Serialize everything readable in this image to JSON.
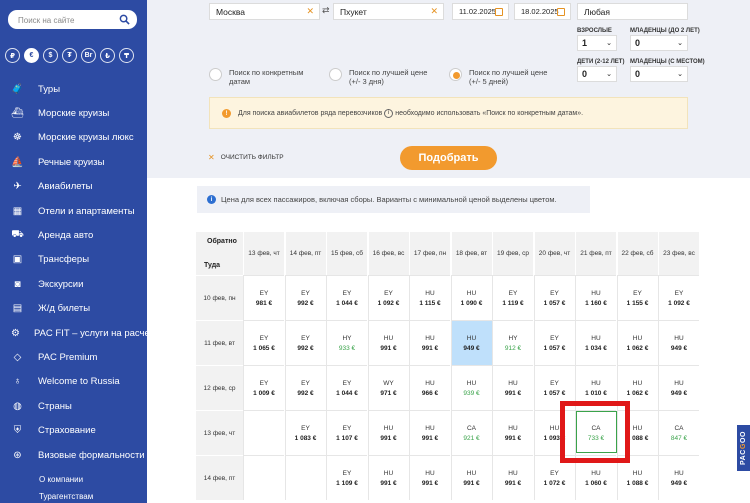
{
  "sidebar": {
    "search_placeholder": "Поиск на сайте",
    "currencies": [
      "₽",
      "€",
      "$",
      "₮",
      "Br",
      "₺",
      "₸"
    ],
    "items": [
      {
        "label": "Туры",
        "icon": "suitcase-icon",
        "glyph": "🧳"
      },
      {
        "label": "Морские круизы",
        "icon": "ship-icon",
        "glyph": "⛴"
      },
      {
        "label": "Морские круизы люкс",
        "icon": "helm-icon",
        "glyph": "☸"
      },
      {
        "label": "Речные круизы",
        "icon": "boat-icon",
        "glyph": "⛵"
      },
      {
        "label": "Авиабилеты",
        "icon": "plane-icon",
        "glyph": "✈"
      },
      {
        "label": "Отели и апартаменты",
        "icon": "building-icon",
        "glyph": "▦"
      },
      {
        "label": "Аренда авто",
        "icon": "car-icon",
        "glyph": "⛟"
      },
      {
        "label": "Трансферы",
        "icon": "bus-icon",
        "glyph": "▣"
      },
      {
        "label": "Экскурсии",
        "icon": "camera-icon",
        "glyph": "◙"
      },
      {
        "label": "Ж/д билеты",
        "icon": "train-icon",
        "glyph": "▤"
      },
      {
        "label": "PAC FIT – услуги на расчет",
        "icon": "gear-icon",
        "glyph": "⚙"
      },
      {
        "label": "PAC Premium",
        "icon": "diamond-icon",
        "glyph": "◇"
      },
      {
        "label": "Welcome to Russia",
        "icon": "matryoshka-icon",
        "glyph": "♁"
      },
      {
        "label": "Страны",
        "icon": "globe-icon",
        "glyph": "◍"
      },
      {
        "label": "Страхование",
        "icon": "shield-icon",
        "glyph": "⛨"
      },
      {
        "label": "Визовые формальности",
        "icon": "passport-icon",
        "glyph": "⊛"
      }
    ],
    "sub_items": [
      "О компании",
      "Турагентствам"
    ]
  },
  "search": {
    "from": "Москва",
    "to": "Пхукет",
    "date_from": "11.02.2025",
    "date_to": "18.02.2025",
    "class": "Любая",
    "adults_label": "Взрослые",
    "adults": "1",
    "infants_label": "Младенцы (до 2 лет)",
    "infants": "0",
    "children_label": "Дети (2-12 лет)",
    "children": "0",
    "infants_seat_label": "Младенцы (с местом)",
    "infants_seat": "0",
    "radio": [
      {
        "label": "Поиск по конкретным датам",
        "checked": false
      },
      {
        "label": "Поиск по лучшей цене (+/- 3 дня)",
        "checked": false
      },
      {
        "label": "Поиск по лучшей цене (+/- 5 дней)",
        "checked": true
      }
    ],
    "warning_before": "Для поиска авиабилетов ряда перевозчиков",
    "warning_after": "необходимо использовать «Поиск по конкретным датам».",
    "clear_filter": "Очистить фильтр",
    "submit": "Подобрать",
    "info": "Цена для всех пассажиров, включая сборы. Варианты с минимальной ценой выделены цветом."
  },
  "table": {
    "corner_top": "Обратно",
    "corner_bottom": "Туда",
    "columns": [
      "13 фев, чт",
      "14 фев, пт",
      "15 фев, сб",
      "16 фев, вс",
      "17 фев, пн",
      "18 фев, вт",
      "19 фев, ср",
      "20 фев, чт",
      "21 фев, пт",
      "22 фев, сб",
      "23 фев, вс"
    ],
    "rows": [
      {
        "label": "10 фев, пн",
        "cells": [
          [
            "EY",
            "981 €"
          ],
          [
            "EY",
            "992 €"
          ],
          [
            "EY",
            "1 044 €"
          ],
          [
            "EY",
            "1 092 €"
          ],
          [
            "HU",
            "1 115 €"
          ],
          [
            "HU",
            "1 090 €"
          ],
          [
            "EY",
            "1 119 €"
          ],
          [
            "EY",
            "1 057 €"
          ],
          [
            "HU",
            "1 160 €"
          ],
          [
            "EY",
            "1 155 €"
          ],
          [
            "EY",
            "1 092 €"
          ]
        ]
      },
      {
        "label": "11 фев, вт",
        "cells": [
          [
            "EY",
            "1 065 €"
          ],
          [
            "EY",
            "992 €"
          ],
          [
            "HY",
            "933 €"
          ],
          [
            "HU",
            "991 €"
          ],
          [
            "HU",
            "991 €"
          ],
          [
            "HU",
            "949 €"
          ],
          [
            "HY",
            "912 €"
          ],
          [
            "EY",
            "1 057 €"
          ],
          [
            "HU",
            "1 034 €"
          ],
          [
            "HU",
            "1 062 €"
          ],
          [
            "HU",
            "949 €"
          ]
        ]
      },
      {
        "label": "12 фев, ср",
        "cells": [
          [
            "EY",
            "1 009 €"
          ],
          [
            "EY",
            "992 €"
          ],
          [
            "EY",
            "1 044 €"
          ],
          [
            "WY",
            "971 €"
          ],
          [
            "HU",
            "966 €"
          ],
          [
            "HU",
            "939 €"
          ],
          [
            "HU",
            "991 €"
          ],
          [
            "EY",
            "1 057 €"
          ],
          [
            "HU",
            "1 010 €"
          ],
          [
            "HU",
            "1 062 €"
          ],
          [
            "HU",
            "949 €"
          ]
        ]
      },
      {
        "label": "13 фев, чт",
        "cells": [
          [
            "",
            ""
          ],
          [
            "EY",
            "1 083 €"
          ],
          [
            "EY",
            "1 107 €"
          ],
          [
            "HU",
            "991 €"
          ],
          [
            "HU",
            "991 €"
          ],
          [
            "CA",
            "921 €"
          ],
          [
            "HU",
            "991 €"
          ],
          [
            "HU",
            "1 093 €"
          ],
          [
            "CA",
            "733 €"
          ],
          [
            "HU",
            "1 088 €"
          ],
          [
            "CA",
            "847 €"
          ]
        ]
      },
      {
        "label": "14 фев, пт",
        "cells": [
          [
            "",
            ""
          ],
          [
            "",
            ""
          ],
          [
            "EY",
            "1 109 €"
          ],
          [
            "HU",
            "991 €"
          ],
          [
            "HU",
            "991 €"
          ],
          [
            "HU",
            "991 €"
          ],
          [
            "HU",
            "991 €"
          ],
          [
            "EY",
            "1 072 €"
          ],
          [
            "HU",
            "1 060 €"
          ],
          [
            "HU",
            "1 088 €"
          ],
          [
            "HU",
            "949 €"
          ]
        ]
      }
    ],
    "best_cells": [
      "1-2",
      "1-6",
      "2-5",
      "3-5",
      "3-8",
      "3-10"
    ],
    "selected_cell": "1-5"
  },
  "brand_tab": {
    "left": "PAC",
    "accent": "G",
    "right": "OO"
  },
  "colors": {
    "sidebar": "#2d4ba3",
    "accent": "#f29a2e",
    "best_price": "#3aa34a",
    "selected": "#bfe0fb",
    "highlight_box": "#e01818"
  }
}
